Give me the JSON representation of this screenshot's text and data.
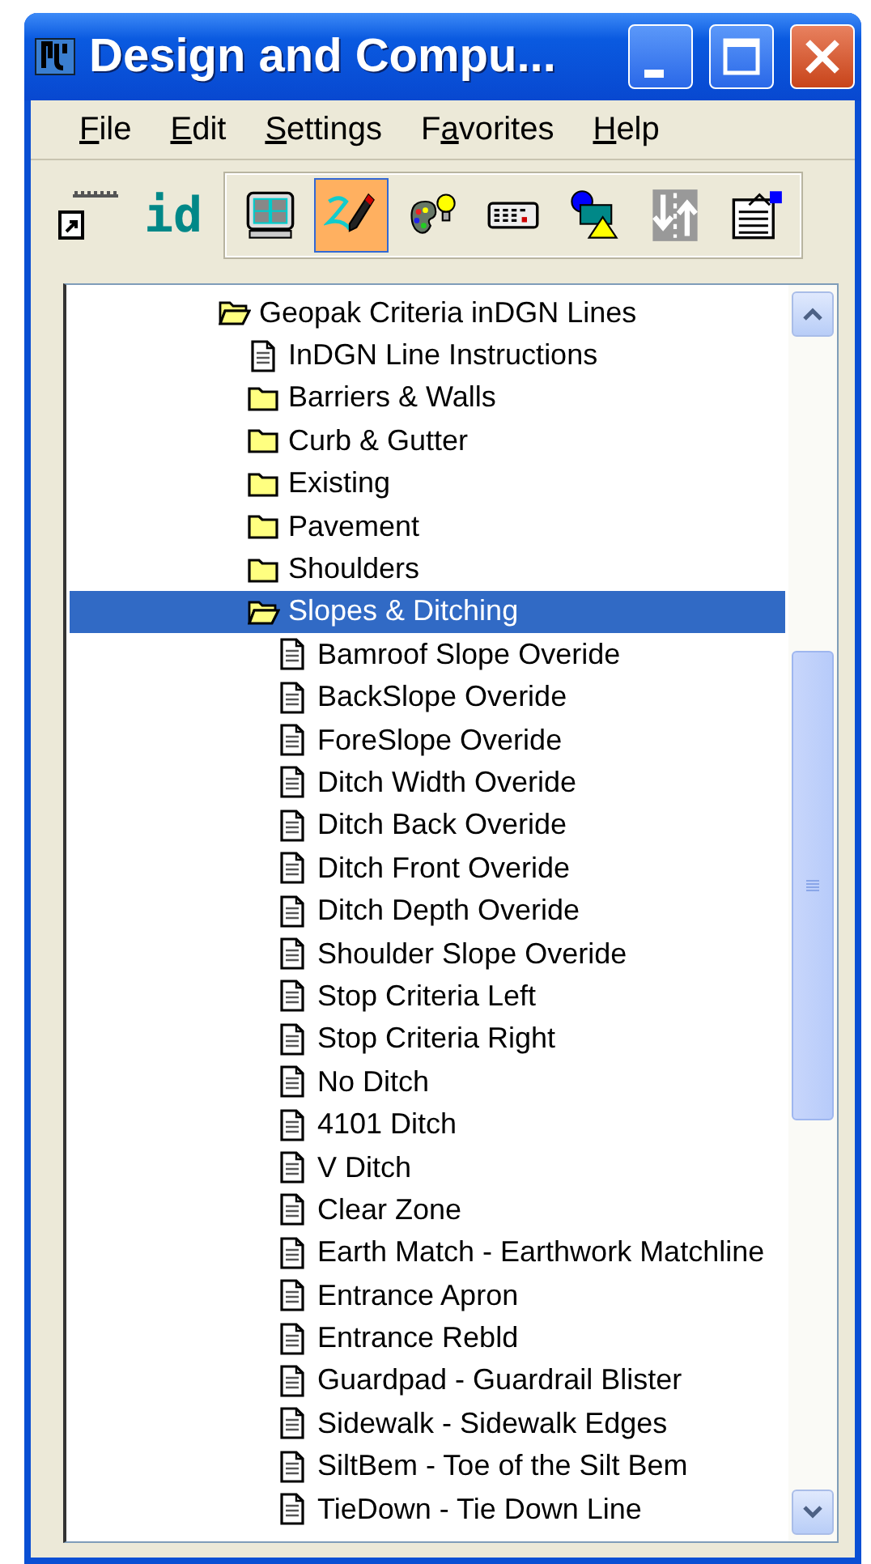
{
  "window": {
    "title": "Design and Compu..."
  },
  "menu": [
    {
      "mnemonic": "F",
      "after": "ile"
    },
    {
      "mnemonic": "E",
      "after": "dit"
    },
    {
      "mnemonic": "S",
      "after": "ettings"
    },
    {
      "before": "F",
      "mnemonic": "a",
      "after": "vorites"
    },
    {
      "mnemonic": "H",
      "after": "elp"
    }
  ],
  "toolbar": {
    "label": "id",
    "tools": [
      {
        "selected": false
      },
      {
        "selected": true
      },
      {
        "selected": false
      },
      {
        "selected": false
      },
      {
        "selected": false
      },
      {
        "selected": false
      },
      {
        "selected": false
      }
    ]
  },
  "tree": {
    "items": [
      {
        "kind": "folder",
        "label": "Geopak Criteria inDGN Lines",
        "expanded": true,
        "selected": false,
        "children": [
          {
            "kind": "document",
            "label": "InDGN Line Instructions",
            "selected": false
          },
          {
            "kind": "folder",
            "label": "Barriers & Walls",
            "expanded": false,
            "selected": false
          },
          {
            "kind": "folder",
            "label": "Curb & Gutter",
            "expanded": false,
            "selected": false
          },
          {
            "kind": "folder",
            "label": "Existing",
            "expanded": false,
            "selected": false
          },
          {
            "kind": "folder",
            "label": "Pavement",
            "expanded": false,
            "selected": false
          },
          {
            "kind": "folder",
            "label": "Shoulders",
            "expanded": false,
            "selected": false
          },
          {
            "kind": "folder",
            "label": "Slopes & Ditching",
            "expanded": true,
            "selected": true,
            "children": [
              {
                "kind": "document",
                "label": "Bamroof Slope Overide",
                "selected": false
              },
              {
                "kind": "document",
                "label": "BackSlope Overide",
                "selected": false
              },
              {
                "kind": "document",
                "label": "ForeSlope Overide",
                "selected": false
              },
              {
                "kind": "document",
                "label": "Ditch Width Overide",
                "selected": false
              },
              {
                "kind": "document",
                "label": "Ditch Back Overide",
                "selected": false
              },
              {
                "kind": "document",
                "label": "Ditch Front Overide",
                "selected": false
              },
              {
                "kind": "document",
                "label": "Ditch Depth Overide",
                "selected": false
              },
              {
                "kind": "document",
                "label": "Shoulder Slope Overide",
                "selected": false
              },
              {
                "kind": "document",
                "label": "Stop Criteria Left",
                "selected": false
              },
              {
                "kind": "document",
                "label": "Stop Criteria Right",
                "selected": false
              },
              {
                "kind": "document",
                "label": "No Ditch",
                "selected": false
              },
              {
                "kind": "document",
                "label": "4101 Ditch",
                "selected": false
              },
              {
                "kind": "document",
                "label": "V Ditch",
                "selected": false
              },
              {
                "kind": "document",
                "label": "Clear Zone",
                "selected": false
              },
              {
                "kind": "document",
                "label": "Earth Match - Earthwork Matchline",
                "selected": false
              },
              {
                "kind": "document",
                "label": "Entrance Apron",
                "selected": false
              },
              {
                "kind": "document",
                "label": "Entrance Rebld",
                "selected": false
              },
              {
                "kind": "document",
                "label": "Guardpad - Guardrail Blister",
                "selected": false
              },
              {
                "kind": "document",
                "label": "Sidewalk - Sidewalk Edges",
                "selected": false
              },
              {
                "kind": "document",
                "label": "SiltBem - Toe of the Silt Bem",
                "selected": false
              },
              {
                "kind": "document",
                "label": "TieDown - Tie Down Line",
                "selected": false
              }
            ]
          }
        ]
      }
    ]
  }
}
